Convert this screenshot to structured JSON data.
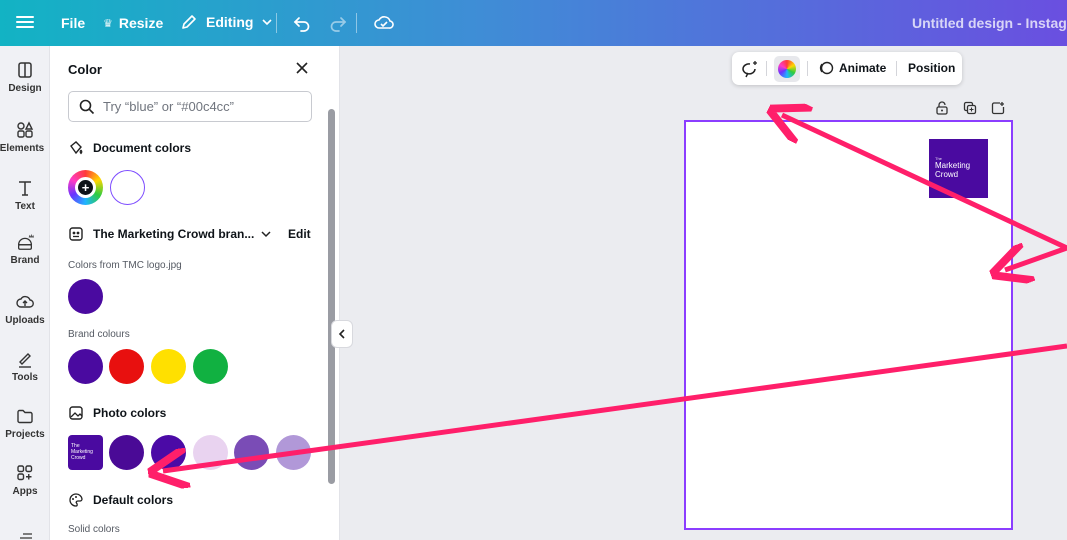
{
  "topbar": {
    "file_label": "File",
    "resize_label": "Resize",
    "editing_label": "Editing",
    "title": "Untitled design - Instagram P"
  },
  "rail": [
    {
      "label": "Design",
      "icon": "design-icon"
    },
    {
      "label": "Elements",
      "icon": "elements-icon"
    },
    {
      "label": "Text",
      "icon": "text-icon"
    },
    {
      "label": "Brand",
      "icon": "brand-icon"
    },
    {
      "label": "Uploads",
      "icon": "uploads-icon"
    },
    {
      "label": "Tools",
      "icon": "tools-icon"
    },
    {
      "label": "Projects",
      "icon": "projects-icon"
    },
    {
      "label": "Apps",
      "icon": "apps-icon"
    }
  ],
  "panel": {
    "title": "Color",
    "search_placeholder": "Try “blue” or “#00c4cc”",
    "document_colors": {
      "heading": "Document colors",
      "swatches": [
        "#ffffff"
      ]
    },
    "brand_kit": {
      "heading": "The Marketing Crowd bran...",
      "edit_label": "Edit",
      "logo_colors_label": "Colors from TMC logo.jpg",
      "logo_colors": [
        "#4a0aa0"
      ],
      "brand_colours_label": "Brand colours",
      "brand_colours": [
        "#4a0aa0",
        "#e8100f",
        "#ffe000",
        "#11b141"
      ]
    },
    "photo_colors": {
      "heading": "Photo colors",
      "thumb_text": [
        "The",
        "Marketing",
        "Crowd"
      ],
      "swatches": [
        "#4a0a96",
        "#4b0aa6",
        "#e9d3f0",
        "#7a4cb6",
        "#b198d8"
      ]
    },
    "default_colors": {
      "heading": "Default colors",
      "solid_label": "Solid colors"
    }
  },
  "context_toolbar": {
    "animate_label": "Animate",
    "position_label": "Position"
  },
  "canvas": {
    "logo_text_small": "The",
    "logo_text_line1": "Marketing",
    "logo_text_line2": "Crowd"
  },
  "colors": {
    "accent_purple": "#8b3dff",
    "annotation_arrow": "#ff1f6a"
  }
}
